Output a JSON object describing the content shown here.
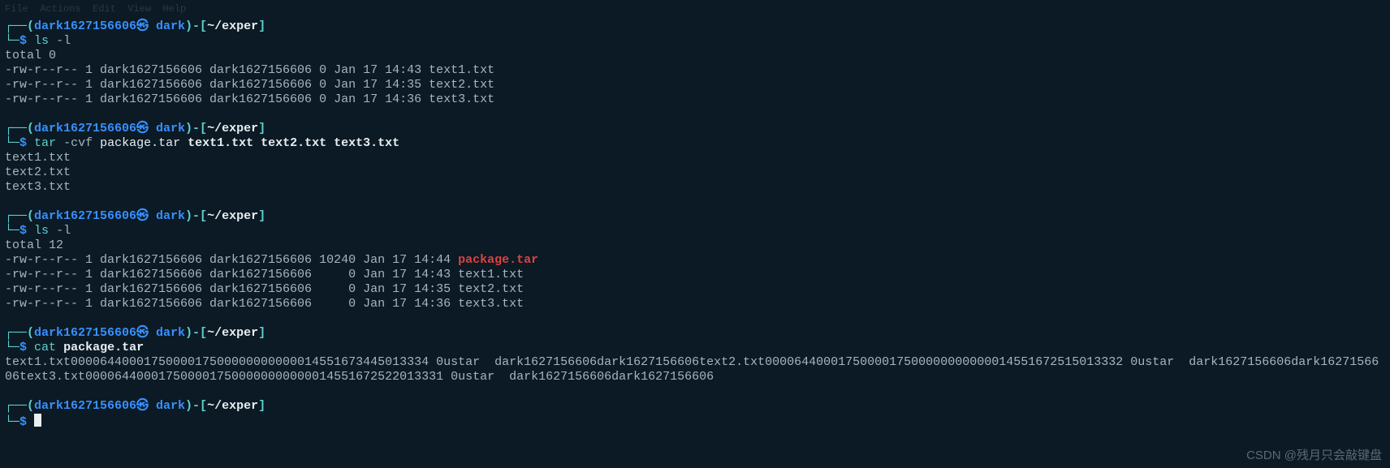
{
  "menubar": "File  Actions  Edit  View  Help",
  "prompt": {
    "user": "dark1627156606",
    "host_suffix": "㉿ dark",
    "sep_open": "┌──(",
    "sep_close": ")-[",
    "path": "~/exper",
    "path_close": "]",
    "cont": "└─",
    "dollar": "$"
  },
  "blocks": [
    {
      "cmd_colored": [
        {
          "t": "ls ",
          "c": "cmd"
        },
        {
          "t": "-l",
          "c": "gray"
        }
      ],
      "output_plain": [
        "total 0",
        "-rw-r--r-- 1 dark1627156606 dark1627156606 0 Jan 17 14:43 text1.txt",
        "-rw-r--r-- 1 dark1627156606 dark1627156606 0 Jan 17 14:35 text2.txt",
        "-rw-r--r-- 1 dark1627156606 dark1627156606 0 Jan 17 14:36 text3.txt"
      ]
    },
    {
      "cmd_colored": [
        {
          "t": "tar ",
          "c": "cmd"
        },
        {
          "t": "-cvf ",
          "c": "gray"
        },
        {
          "t": "package.tar ",
          "c": "white"
        },
        {
          "t": "text1.txt text2.txt text3.txt",
          "c": "whiteb"
        }
      ],
      "output_plain": [
        "text1.txt",
        "text2.txt",
        "text3.txt"
      ]
    },
    {
      "cmd_colored": [
        {
          "t": "ls ",
          "c": "cmd"
        },
        {
          "t": "-l",
          "c": "gray"
        }
      ],
      "output_rows": [
        [
          {
            "t": "total 12",
            "c": "gray"
          }
        ],
        [
          {
            "t": "-rw-r--r-- 1 dark1627156606 dark1627156606 10240 Jan 17 14:44 ",
            "c": "gray"
          },
          {
            "t": "package.tar",
            "c": "red"
          }
        ],
        [
          {
            "t": "-rw-r--r-- 1 dark1627156606 dark1627156606     0 Jan 17 14:43 text1.txt",
            "c": "gray"
          }
        ],
        [
          {
            "t": "-rw-r--r-- 1 dark1627156606 dark1627156606     0 Jan 17 14:35 text2.txt",
            "c": "gray"
          }
        ],
        [
          {
            "t": "-rw-r--r-- 1 dark1627156606 dark1627156606     0 Jan 17 14:36 text3.txt",
            "c": "gray"
          }
        ]
      ]
    },
    {
      "cmd_colored": [
        {
          "t": "cat ",
          "c": "cmd"
        },
        {
          "t": "package.tar",
          "c": "whiteb"
        }
      ],
      "output_wrap": "text1.txt0000644000175000017500000000000014551673445013334 0ustar  dark1627156606dark1627156606text2.txt0000644000175000017500000000000014551672515013332 0ustar  dark1627156606dark1627156606text3.txt0000644000175000017500000000000014551672522013331 0ustar  dark1627156606dark1627156606"
    },
    {
      "cmd_colored": [],
      "cursor": true
    }
  ],
  "watermark": "CSDN @残月只会敲键盘"
}
